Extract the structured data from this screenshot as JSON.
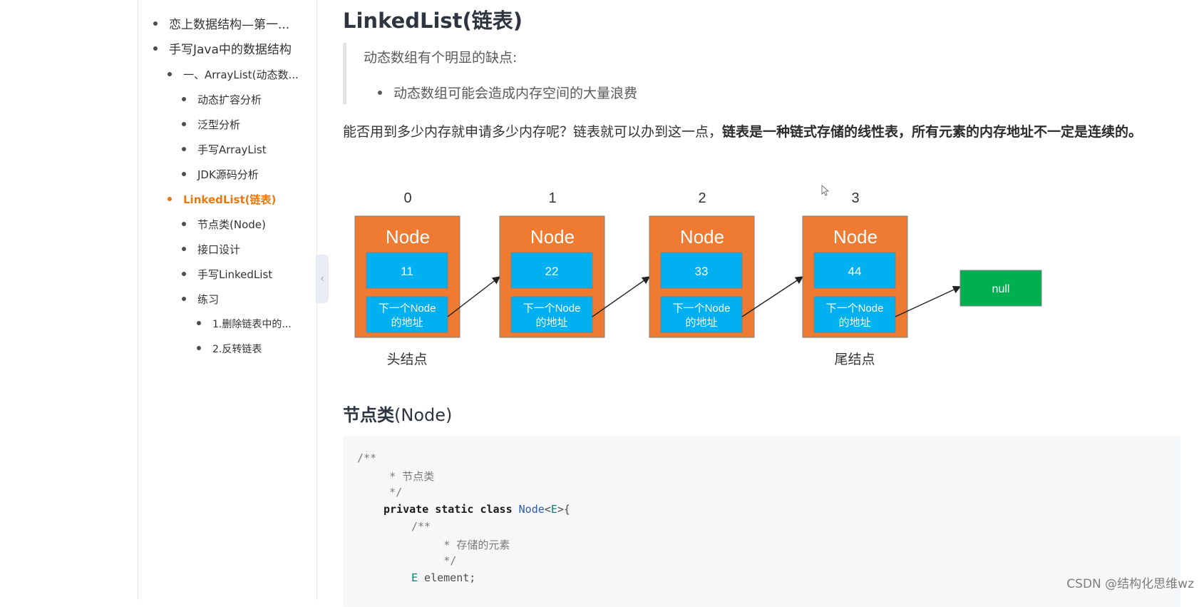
{
  "toc": {
    "items": [
      {
        "label": "恋上数据结构—第一...",
        "level": 1,
        "active": false
      },
      {
        "label": "手写Java中的数据结构",
        "level": 1,
        "active": false
      },
      {
        "label": "一、ArrayList(动态数...",
        "level": 2,
        "active": false
      },
      {
        "label": "动态扩容分析",
        "level": 3,
        "active": false
      },
      {
        "label": "泛型分析",
        "level": 3,
        "active": false
      },
      {
        "label": "手写ArrayList",
        "level": 3,
        "active": false
      },
      {
        "label": "JDK源码分析",
        "level": 3,
        "active": false
      },
      {
        "label": "LinkedList(链表)",
        "level": 2,
        "active": true
      },
      {
        "label": "节点类(Node)",
        "level": 3,
        "active": false
      },
      {
        "label": "接口设计",
        "level": 3,
        "active": false
      },
      {
        "label": "手写LinkedList",
        "level": 3,
        "active": false
      },
      {
        "label": "练习",
        "level": 3,
        "active": false
      },
      {
        "label": "1.删除链表中的...",
        "level": 4,
        "active": false
      },
      {
        "label": "2.反转链表",
        "level": 4,
        "active": false
      }
    ],
    "collapse_icon": "chevron-left-icon"
  },
  "article": {
    "heading": "LinkedList(链表)",
    "quote": {
      "text": "动态数组有个明显的缺点:",
      "bullet": "动态数组可能会造成内存空间的大量浪费"
    },
    "paragraph": {
      "plain": "能否用到多少内存就申请多少内存呢？链表就可以办到这一点，",
      "bold": "链表是一种链式存储的线性表，所有元素的内存地址不一定是连续的。"
    },
    "diagram": {
      "nodes": [
        {
          "index": "0",
          "title": "Node",
          "value": "11",
          "next_label_1": "下一个Node",
          "next_label_2": "的地址"
        },
        {
          "index": "1",
          "title": "Node",
          "value": "22",
          "next_label_1": "下一个Node",
          "next_label_2": "的地址"
        },
        {
          "index": "2",
          "title": "Node",
          "value": "33",
          "next_label_1": "下一个Node",
          "next_label_2": "的地址"
        },
        {
          "index": "3",
          "title": "Node",
          "value": "44",
          "next_label_1": "下一个Node",
          "next_label_2": "的地址"
        }
      ],
      "null_label": "null",
      "head_label": "头结点",
      "tail_label": "尾结点",
      "colors": {
        "node": "#ee7b31",
        "field": "#00b0f0",
        "null": "#00b050"
      }
    },
    "subheading": {
      "cjk": "节点类",
      "latin": "(Node)"
    },
    "code": {
      "l1": "/**",
      "l2": "     * 节点类",
      "l3": "     */",
      "l4_kw": "private static class ",
      "l4_cls": "Node",
      "l4_rest": "<E>{",
      "l4_gen": "E",
      "l5": "/**",
      "l6": "         * 存储的元素",
      "l7": "         */",
      "l8_type": "E",
      "l8_rest": " element;"
    }
  },
  "watermark": "CSDN @结构化思维wz"
}
